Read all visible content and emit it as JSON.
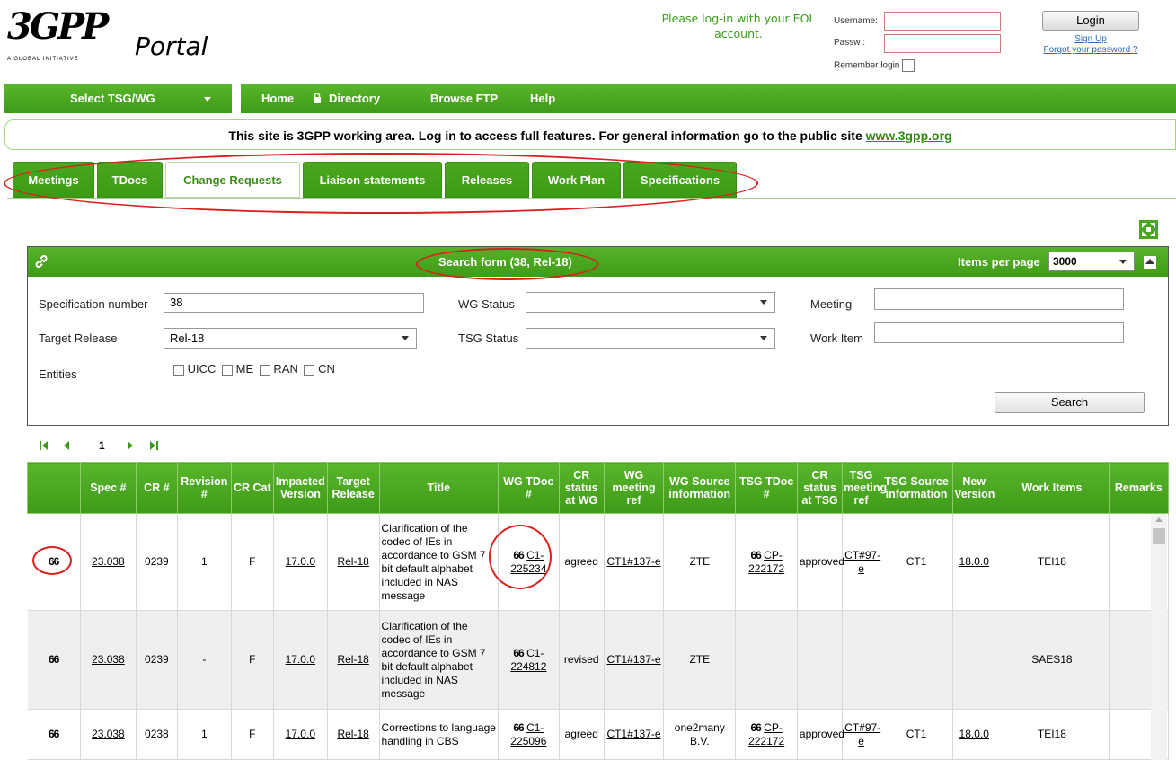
{
  "header": {
    "logo_text": "3GPP",
    "logo_tagline": "A GLOBAL INITIATIVE",
    "portal_text": "Portal",
    "eol_message": "Please log-in with your EOL account.",
    "username_label": "Username:",
    "password_label": "Passw :",
    "remember_label": "Remember login",
    "login_button": "Login",
    "signup_link": "Sign Up",
    "forgot_link": "Forgot your password ?"
  },
  "nav": {
    "select_tsg": "Select TSG/WG",
    "items": [
      "Home",
      "Directory",
      "Browse FTP",
      "Help"
    ]
  },
  "banner": {
    "text": "This site is 3GPP working area. Log in to access full features. For general information go to the public site",
    "link": "www.3gpp.org"
  },
  "tabs": [
    "Meetings",
    "TDocs",
    "Change Requests",
    "Liaison statements",
    "Releases",
    "Work Plan",
    "Specifications"
  ],
  "active_tab": "Change Requests",
  "search": {
    "title": "Search form (38, Rel-18)",
    "items_per_page_label": "Items per page",
    "items_per_page_value": "3000",
    "spec_label": "Specification number",
    "spec_value": "38",
    "target_release_label": "Target Release",
    "target_release_value": "Rel-18",
    "entities_label": "Entities",
    "entities": [
      "UICC",
      "ME",
      "RAN",
      "CN"
    ],
    "wg_status_label": "WG Status",
    "wg_status_value": "",
    "tsg_status_label": "TSG Status",
    "tsg_status_value": "",
    "meeting_label": "Meeting",
    "meeting_value": "",
    "work_item_label": "Work Item",
    "work_item_value": "",
    "search_button": "Search"
  },
  "pager": {
    "current_page": "1"
  },
  "table": {
    "columns": [
      "",
      "Spec #",
      "CR #",
      "Revision #",
      "CR Cat",
      "Impacted Version",
      "Target Release",
      "Title",
      "WG TDoc #",
      "CR status at WG",
      "WG meeting ref",
      "WG Source information",
      "TSG TDoc #",
      "CR status at TSG",
      "TSG meeting ref",
      "TSG Source information",
      "New Version",
      "Work Items",
      "Remarks"
    ],
    "rows": [
      {
        "spec": "23.038",
        "cr": "0239",
        "rev": "1",
        "cat": "F",
        "impacted": "17.0.0",
        "target": "Rel-18",
        "title": "Clarification of the codec of IEs in accordance to GSM 7 bit default alphabet included in NAS message",
        "wg_tdoc": "C1-225234",
        "wg_status": "agreed",
        "wg_meeting": "CT1#137-e",
        "wg_source": "ZTE",
        "tsg_tdoc": "CP-222172",
        "tsg_status": "approved",
        "tsg_meeting": "CT#97-e",
        "tsg_source": "CT1",
        "new_version": "18.0.0",
        "work_items": "TEI18",
        "remarks": ""
      },
      {
        "spec": "23.038",
        "cr": "0239",
        "rev": "-",
        "cat": "F",
        "impacted": "17.0.0",
        "target": "Rel-18",
        "title": "Clarification of the codec of IEs in accordance to GSM 7 bit default alphabet included in NAS message",
        "wg_tdoc": "C1-224812",
        "wg_status": "revised",
        "wg_meeting": "CT1#137-e",
        "wg_source": "ZTE",
        "tsg_tdoc": "",
        "tsg_status": "",
        "tsg_meeting": "",
        "tsg_source": "",
        "new_version": "",
        "work_items": "SAES18",
        "remarks": ""
      },
      {
        "spec": "23.038",
        "cr": "0238",
        "rev": "1",
        "cat": "F",
        "impacted": "17.0.0",
        "target": "Rel-18",
        "title": "Corrections to language handling in CBS",
        "wg_tdoc": "C1-225096",
        "wg_status": "agreed",
        "wg_meeting": "CT1#137-e",
        "wg_source": "one2many B.V.",
        "tsg_tdoc": "CP-222172",
        "tsg_status": "approved",
        "tsg_meeting": "CT#97-e",
        "tsg_source": "CT1",
        "new_version": "18.0.0",
        "work_items": "TEI18",
        "remarks": ""
      }
    ]
  },
  "colors": {
    "green": "#4aa820",
    "annotation_red": "#d9201e"
  },
  "icons": [
    "glasses-icon",
    "lock-icon",
    "link-icon",
    "expand-icon",
    "collapse-icon",
    "first-page-icon",
    "prev-page-icon",
    "next-page-icon",
    "last-page-icon"
  ]
}
